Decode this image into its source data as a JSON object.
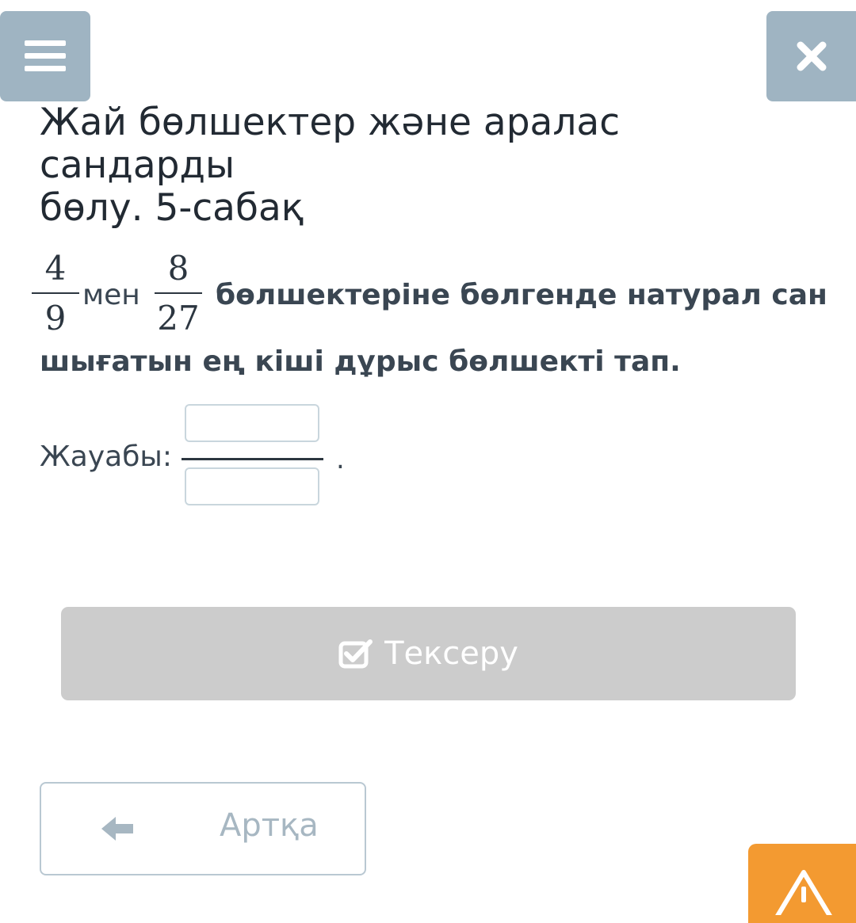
{
  "header": {
    "menu_icon": "hamburger-menu-icon",
    "close_icon": "close-icon",
    "button_color": "#9fb4c2"
  },
  "lesson": {
    "title_line1": "Жай бөлшектер және аралас сандарды",
    "title_line2": "бөлу. 5-сабақ"
  },
  "question": {
    "fraction1": {
      "numerator": "4",
      "denominator": "9"
    },
    "connector": "мен",
    "fraction2": {
      "numerator": "8",
      "denominator": "27"
    },
    "text_line1": "бөлшектеріне бөлгенде натурал сан",
    "text_line2": "шығатын ең кіші дұрыс бөлшекті тап."
  },
  "answer": {
    "label": "Жауабы:",
    "numerator_value": "",
    "denominator_value": "",
    "trailing": "."
  },
  "actions": {
    "check_label": "Тексеру",
    "check_icon": "checkbox-check-icon",
    "check_color": "#cccccc",
    "back_label": "Артқа",
    "back_icon": "arrow-left-icon",
    "report_icon": "warning-icon",
    "report_color": "#f39a31"
  }
}
